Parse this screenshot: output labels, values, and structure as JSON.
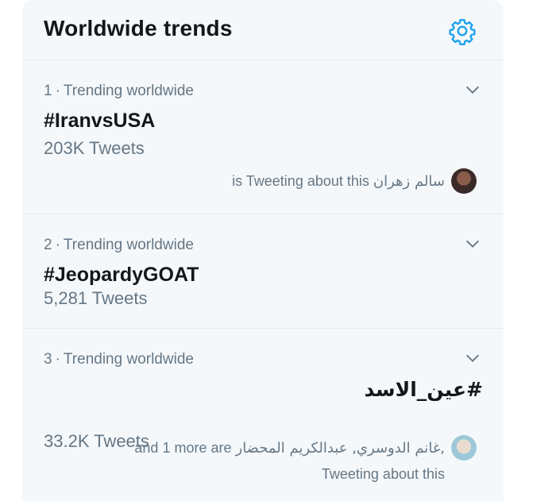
{
  "header": {
    "title": "Worldwide trends",
    "settings_icon": "gear-icon",
    "accent": "#1da1f2"
  },
  "trends": [
    {
      "rank": "1",
      "context": "Trending worldwide",
      "name": "#IranvsUSA",
      "count": "203K Tweets",
      "tweeting_users": "سالم زهران",
      "tweeting_suffix": "is Tweeting about this"
    },
    {
      "rank": "2",
      "context": "Trending worldwide",
      "name": "#JeopardyGOAT",
      "count": "5,281 Tweets"
    },
    {
      "rank": "3",
      "context": "Trending worldwide",
      "name": "#عين_الاسد",
      "count": "33.2K Tweets",
      "tweeting_users": "غانم الدوسري, عبدالكريم المحضار,",
      "tweeting_suffix_line1": "and 1 more are",
      "tweeting_suffix_line2": "Tweeting about this"
    }
  ],
  "colors": {
    "panel_bg": "#f5f8fa",
    "divider": "#e1e8ed",
    "secondary_text": "#657786",
    "primary_text": "#14171a"
  }
}
